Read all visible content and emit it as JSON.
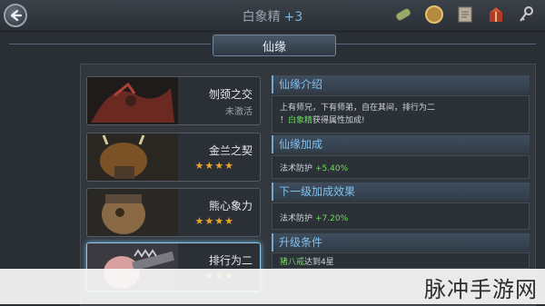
{
  "header": {
    "title": "白象精",
    "level": "+3",
    "icons": [
      "scroll-icon",
      "coin-icon",
      "map-icon",
      "gift-icon",
      "key-icon"
    ]
  },
  "banner": {
    "label": "仙缘"
  },
  "cards": [
    {
      "name": "刎颈之交",
      "sub": "未激活",
      "stars": "",
      "active": false
    },
    {
      "name": "金兰之契",
      "sub": "",
      "stars": "★★★★",
      "active": false
    },
    {
      "name": "熊心象力",
      "sub": "",
      "stars": "★★★★",
      "active": false
    },
    {
      "name": "排行为二",
      "sub": "",
      "stars": "★★★",
      "active": true
    }
  ],
  "intro": {
    "title": "仙缘介绍",
    "line1": "上有师兄，下有师弟，自在其间，排行为二",
    "line2_prefix": "！",
    "line2_highlight": "白象精",
    "line2_suffix": "获得属性加成!"
  },
  "bonus": {
    "title": "仙缘加成",
    "label": "法术防护",
    "value": "+5.40%"
  },
  "next_bonus": {
    "title": "下一级加成效果",
    "label": "法术防护",
    "value": "+7.20%"
  },
  "upgrade": {
    "title": "升级条件",
    "condition_highlight": "猪八戒",
    "condition_suffix": "达到4星"
  },
  "watermark": "脉冲手游网"
}
